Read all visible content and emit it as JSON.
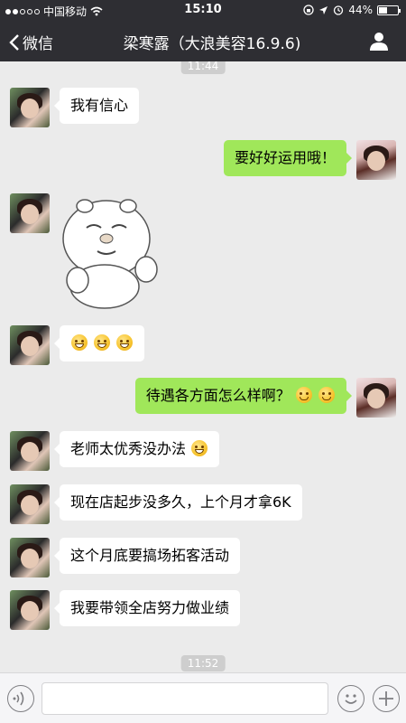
{
  "status_bar": {
    "carrier": "中国移动",
    "time": "15:10",
    "battery_percent": "44%",
    "battery_level": 0.44,
    "signal_bars_filled": 2,
    "signal_bars_total": 5
  },
  "nav": {
    "back_label": "微信",
    "title": "梁寒露（大浪美容16.9.6)"
  },
  "chat": {
    "time_top": "11:44",
    "messages": [
      {
        "side": "left",
        "type": "text",
        "text": "我有信心"
      },
      {
        "side": "right",
        "type": "text",
        "text": "要好好运用哦！"
      },
      {
        "side": "left",
        "type": "sticker",
        "sticker": "cartoon-sticker"
      },
      {
        "side": "left",
        "type": "emoji",
        "emoji": [
          "grin-emoji",
          "grin-emoji",
          "grin-emoji"
        ]
      },
      {
        "side": "right",
        "type": "text",
        "text": "待遇各方面怎么样啊？",
        "emoji": [
          "smile-emoji",
          "smile-emoji"
        ]
      },
      {
        "side": "left",
        "type": "text",
        "text": "老师太优秀没办法",
        "emoji": [
          "teeth-emoji"
        ]
      },
      {
        "side": "left",
        "type": "text",
        "text": "现在店起步没多久，上个月才拿6K"
      },
      {
        "side": "left",
        "type": "text",
        "text": "这个月底要搞场拓客活动"
      },
      {
        "side": "left",
        "type": "text",
        "text": "我要带领全店努力做业绩"
      }
    ],
    "time_bottom": "11:52"
  },
  "input_bar": {
    "voice_icon": "voice-icon",
    "emoji_icon": "emoji-icon",
    "plus_icon": "plus-icon",
    "text_value": ""
  },
  "colors": {
    "header_bg": "#2e2e33",
    "chat_bg": "#ebebeb",
    "bubble_me": "#a0e75a",
    "bubble_friend": "#ffffff"
  }
}
